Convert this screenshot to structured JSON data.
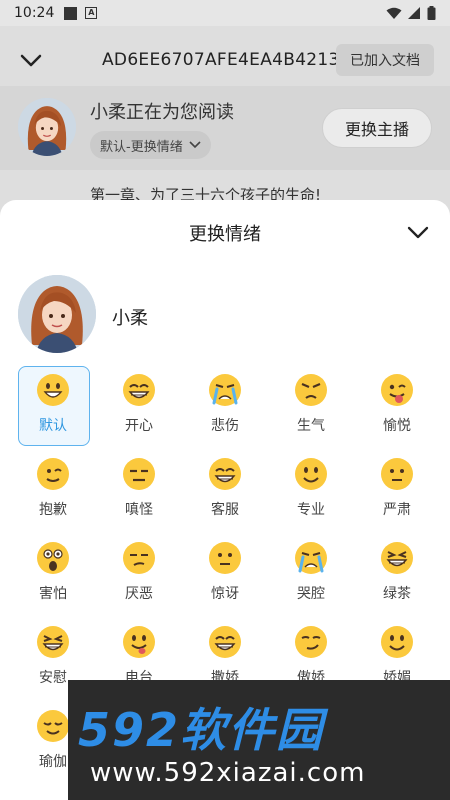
{
  "status_bar": {
    "time": "10:24"
  },
  "header": {
    "doc_id": "AD6EE6707AFE4EA4B4213",
    "added_label": "已加入文档"
  },
  "reader": {
    "title": "小柔正在为您阅读",
    "emotion_pill": "默认-更换情绪",
    "switch_button": "更换主播"
  },
  "content": {
    "chapter": "第一章、为了三十六个孩子的生命!"
  },
  "sheet": {
    "title": "更换情绪",
    "anchor_name": "小柔",
    "emotions": [
      {
        "label": "默认",
        "face": "grin",
        "selected": true
      },
      {
        "label": "开心",
        "face": "big-grin"
      },
      {
        "label": "悲伤",
        "face": "cry"
      },
      {
        "label": "生气",
        "face": "angry"
      },
      {
        "label": "愉悦",
        "face": "wink-tongue"
      },
      {
        "label": "抱歉",
        "face": "wink"
      },
      {
        "label": "嗔怪",
        "face": "expressionless"
      },
      {
        "label": "客服",
        "face": "big-grin"
      },
      {
        "label": "专业",
        "face": "smile"
      },
      {
        "label": "严肃",
        "face": "neutral"
      },
      {
        "label": "害怕",
        "face": "scared"
      },
      {
        "label": "厌恶",
        "face": "unamused"
      },
      {
        "label": "惊讶",
        "face": "neutral"
      },
      {
        "label": "哭腔",
        "face": "cry"
      },
      {
        "label": "绿茶",
        "face": "laugh"
      },
      {
        "label": "安慰",
        "face": "laugh"
      },
      {
        "label": "电台",
        "face": "tongue"
      },
      {
        "label": "撒娇",
        "face": "big-grin"
      },
      {
        "label": "傲娇",
        "face": "smirk"
      },
      {
        "label": "娇媚",
        "face": "smile"
      },
      {
        "label": "瑜伽",
        "face": "relieved"
      }
    ]
  },
  "watermark": {
    "brand": "592软件园",
    "url": "www.592xiazai.com"
  },
  "colors": {
    "accent": "#2f97e0",
    "emoji_yellow": "#fbc93d",
    "watermark_blue": "#2e8de6"
  }
}
